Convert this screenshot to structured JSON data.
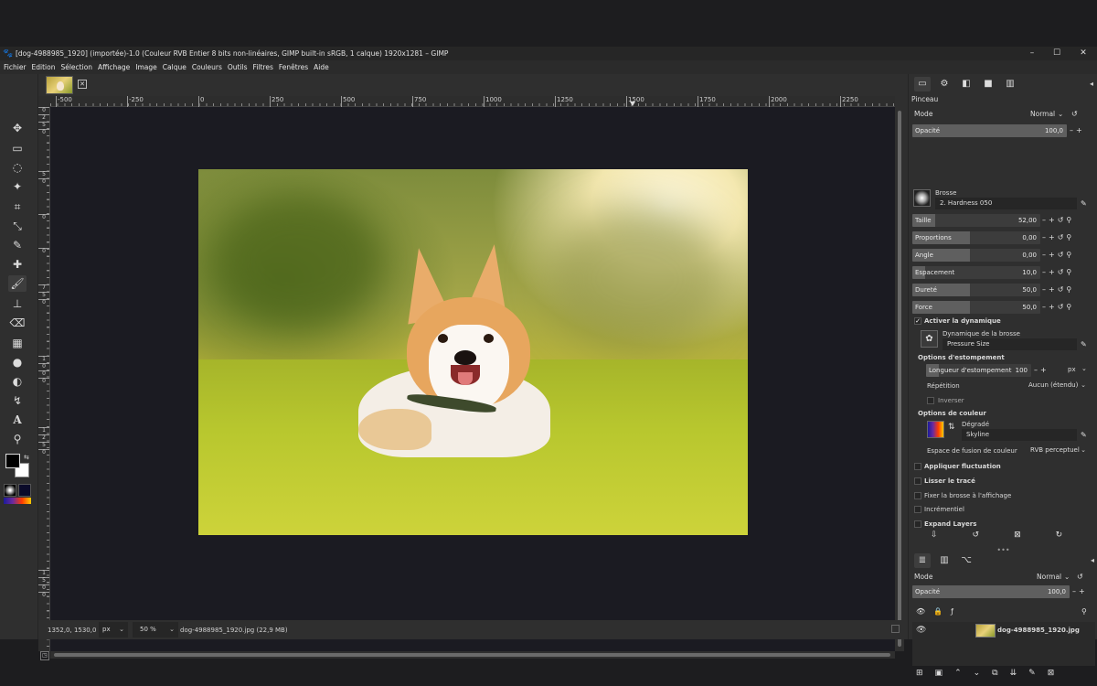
{
  "window": {
    "title": "[dog-4988985_1920] (importée)-1.0 (Couleur RVB Entier 8 bits non-linéaires, GIMP built-in sRGB, 1 calque) 1920x1281 – GIMP",
    "minimize": "–",
    "maximize": "☐",
    "close": "✕"
  },
  "menu": [
    "Fichier",
    "Edition",
    "Sélection",
    "Affichage",
    "Image",
    "Calque",
    "Couleurs",
    "Outils",
    "Filtres",
    "Fenêtres",
    "Aide"
  ],
  "ruler_h": [
    "-500",
    "-250",
    "0",
    "250",
    "500",
    "750",
    "1000",
    "1250",
    "1500",
    "1750",
    "2000",
    "2250"
  ],
  "ruler_v": [
    "0",
    "2",
    "5",
    "0",
    "5",
    "0",
    "0",
    "0",
    "7",
    "5",
    "0",
    "1",
    "0",
    "0",
    "0",
    "1",
    "2",
    "5",
    "0",
    "1",
    "5",
    "0",
    "0"
  ],
  "status": {
    "coords": "1352,0, 1530,0",
    "unit": "px",
    "zoom": "50 %",
    "file": "dog-4988985_1920.jpg (22,9 MB)"
  },
  "tool_options": {
    "panel_title": "Pinceau",
    "mode_label": "Mode",
    "mode_value": "Normal",
    "opacity_label": "Opacité",
    "opacity_value": "100,0",
    "brush_label": "Brosse",
    "brush_name": "2. Hardness 050",
    "sliders": [
      {
        "label": "Taille",
        "value": "52,00",
        "fill": 0.18
      },
      {
        "label": "Proportions",
        "value": "0,00",
        "fill": 0.45
      },
      {
        "label": "Angle",
        "value": "0,00",
        "fill": 0.45
      },
      {
        "label": "Espacement",
        "value": "10,0",
        "fill": 0.1
      },
      {
        "label": "Dureté",
        "value": "50,0",
        "fill": 0.45
      },
      {
        "label": "Force",
        "value": "50,0",
        "fill": 0.45
      }
    ],
    "dynamics_check": "Activer la dynamique",
    "dynamics_label": "Dynamique de la brosse",
    "dynamics_value": "Pressure Size",
    "fade_section": "Options d'estompement",
    "fade_length_label": "Longueur d'estompement",
    "fade_length_value": "100",
    "fade_unit": "px",
    "repeat_label": "Répétition",
    "repeat_value": "Aucun (étendu)",
    "invert_label": "Inverser",
    "color_section": "Options de couleur",
    "gradient_label": "Dégradé",
    "gradient_name": "Skyline",
    "blend_space_label": "Espace de fusion de couleur",
    "blend_space_value": "RVB perceptuel",
    "apply_jitter": "Appliquer fluctuation",
    "smooth_stroke": "Lisser le tracé",
    "lock_brush": "Fixer la brosse à l'affichage",
    "incremental": "Incrémentiel",
    "expand_layers": "Expand Layers"
  },
  "layers": {
    "mode_label": "Mode",
    "mode_value": "Normal",
    "opacity_label": "Opacité",
    "opacity_value": "100,0",
    "layer_name": "dog-4988985_1920.jpg"
  }
}
